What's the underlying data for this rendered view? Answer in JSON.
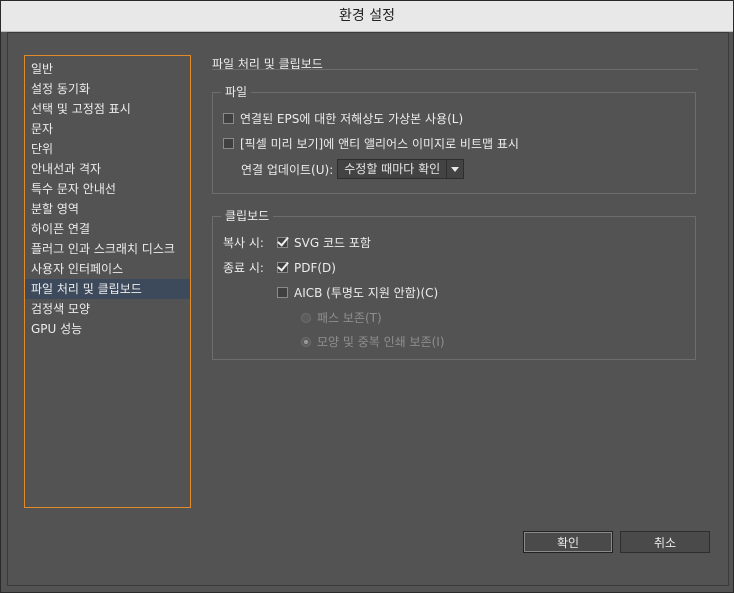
{
  "window": {
    "title": "환경 설정"
  },
  "sidebar": {
    "items": [
      {
        "label": "일반"
      },
      {
        "label": "설정 동기화"
      },
      {
        "label": "선택 및 고정점 표시"
      },
      {
        "label": "문자"
      },
      {
        "label": "단위"
      },
      {
        "label": "안내선과 격자"
      },
      {
        "label": "특수 문자 안내선"
      },
      {
        "label": "분할 영역"
      },
      {
        "label": "하이픈 연결"
      },
      {
        "label": "플러그 인과 스크래치 디스크"
      },
      {
        "label": "사용자 인터페이스"
      },
      {
        "label": "파일 처리 및 클립보드",
        "selected": true
      },
      {
        "label": "검정색 모양"
      },
      {
        "label": "GPU 성능"
      }
    ]
  },
  "panel": {
    "title": "파일 처리 및 클립보드"
  },
  "file_group": {
    "label": "파일",
    "linked_eps": {
      "label": "연결된 EPS에 대한 저해상도 가상본 사용(L)",
      "checked": false
    },
    "pixel_preview": {
      "label": "[픽셀 미리 보기]에 앤티 앨리어스 이미지로 비트맵 표시",
      "checked": false
    },
    "update_links": {
      "label": "연결 업데이트(U):",
      "value": "수정할 때마다 확인"
    }
  },
  "clipboard_group": {
    "label": "클립보드",
    "copy_label": "복사 시:",
    "svg_code": {
      "label": "SVG 코드 포함",
      "checked": true
    },
    "quit_label": "종료 시:",
    "pdf": {
      "label": "PDF(D)",
      "checked": true
    },
    "aicb": {
      "label": "AICB (투명도 지원 안함)(C)",
      "checked": false
    },
    "preserve_paths": {
      "label": "패스 보존(T)",
      "checked": false
    },
    "preserve_appearance": {
      "label": "모양 및 중복 인쇄 보존(I)",
      "checked": true
    }
  },
  "footer": {
    "ok_label": "확인",
    "cancel_label": "취소"
  }
}
